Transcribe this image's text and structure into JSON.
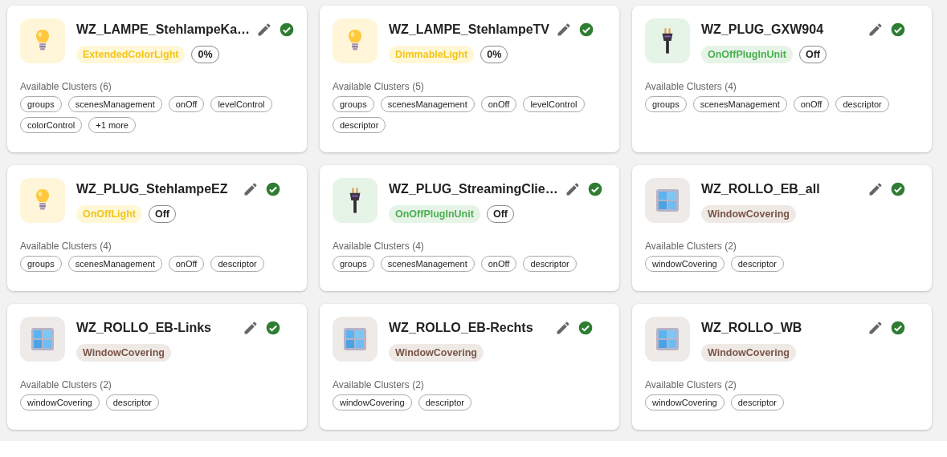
{
  "devices": [
    {
      "name": "WZ_LAMPE_StehlampeKa…",
      "kind": "light",
      "type": "ExtendedColorLight",
      "state": "0%",
      "connected": true,
      "clusters_label": "Available Clusters (6)",
      "clusters": [
        "groups",
        "scenesManagement",
        "onOff",
        "levelControl",
        "colorControl",
        "+1 more"
      ]
    },
    {
      "name": "WZ_LAMPE_StehlampeTV",
      "kind": "light",
      "type": "DimmableLight",
      "state": "0%",
      "connected": true,
      "clusters_label": "Available Clusters (5)",
      "clusters": [
        "groups",
        "scenesManagement",
        "onOff",
        "levelControl",
        "descriptor"
      ]
    },
    {
      "name": "WZ_PLUG_GXW904",
      "kind": "plug",
      "type": "OnOffPlugInUnit",
      "state": "Off",
      "connected": true,
      "clusters_label": "Available Clusters (4)",
      "clusters": [
        "groups",
        "scenesManagement",
        "onOff",
        "descriptor"
      ]
    },
    {
      "name": "WZ_PLUG_StehlampeEZ",
      "kind": "light",
      "type": "OnOffLight",
      "state": "Off",
      "connected": true,
      "clusters_label": "Available Clusters (4)",
      "clusters": [
        "groups",
        "scenesManagement",
        "onOff",
        "descriptor"
      ]
    },
    {
      "name": "WZ_PLUG_StreamingClie…",
      "kind": "plug",
      "type": "OnOffPlugInUnit",
      "state": "Off",
      "connected": true,
      "clusters_label": "Available Clusters (4)",
      "clusters": [
        "groups",
        "scenesManagement",
        "onOff",
        "descriptor"
      ]
    },
    {
      "name": "WZ_ROLLO_EB_all",
      "kind": "window",
      "type": "WindowCovering",
      "connected": true,
      "clusters_label": "Available Clusters (2)",
      "clusters": [
        "windowCovering",
        "descriptor"
      ]
    },
    {
      "name": "WZ_ROLLO_EB-Links",
      "kind": "window",
      "type": "WindowCovering",
      "connected": true,
      "clusters_label": "Available Clusters (2)",
      "clusters": [
        "windowCovering",
        "descriptor"
      ]
    },
    {
      "name": "WZ_ROLLO_EB-Rechts",
      "kind": "window",
      "type": "WindowCovering",
      "connected": true,
      "clusters_label": "Available Clusters (2)",
      "clusters": [
        "windowCovering",
        "descriptor"
      ]
    },
    {
      "name": "WZ_ROLLO_WB",
      "kind": "window",
      "type": "WindowCovering",
      "connected": true,
      "clusters_label": "Available Clusters (2)",
      "clusters": [
        "windowCovering",
        "descriptor"
      ]
    }
  ]
}
